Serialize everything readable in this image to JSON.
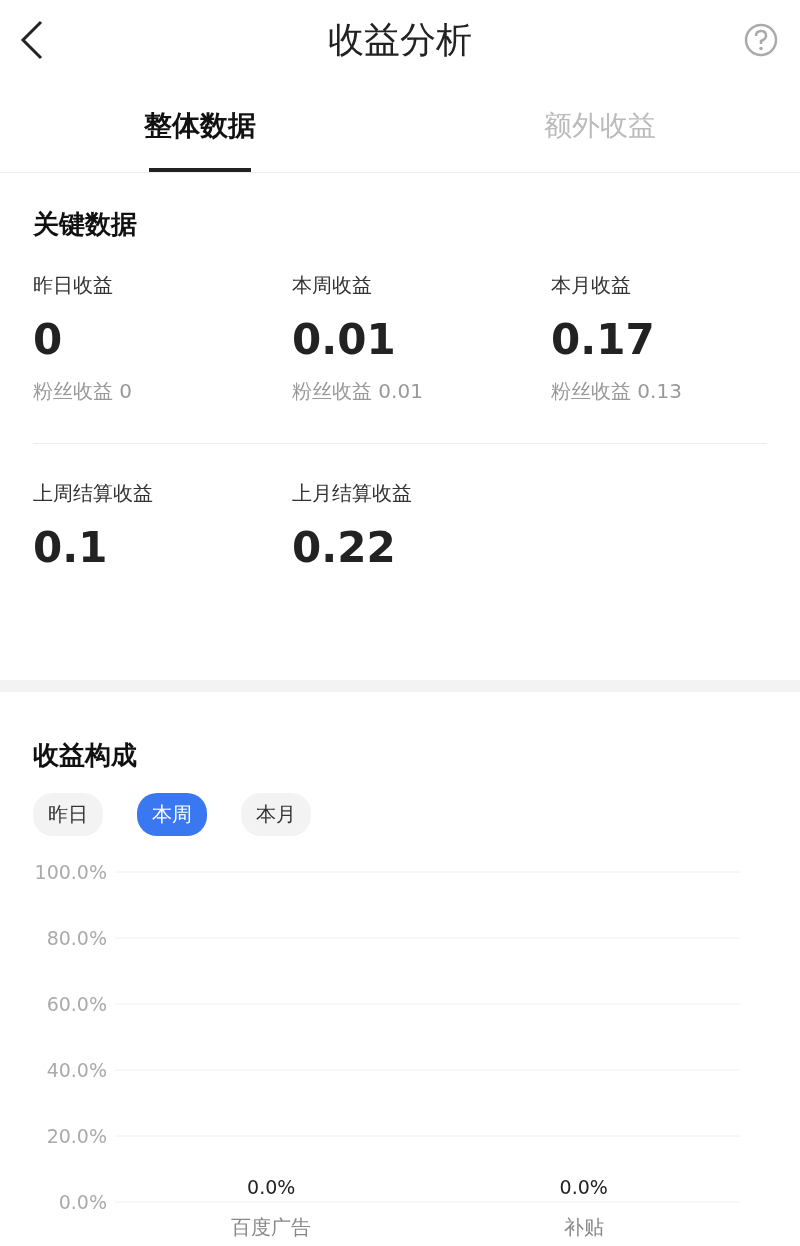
{
  "header": {
    "title": "收益分析"
  },
  "tabs": [
    {
      "label": "整体数据",
      "selected": true
    },
    {
      "label": "额外收益",
      "selected": false
    }
  ],
  "key_data": {
    "title": "关键数据",
    "metrics": [
      {
        "label": "昨日收益",
        "value": "0",
        "sub": "粉丝收益 0"
      },
      {
        "label": "本周收益",
        "value": "0.01",
        "sub": "粉丝收益 0.01"
      },
      {
        "label": "本月收益",
        "value": "0.17",
        "sub": "粉丝收益 0.13"
      }
    ],
    "settled": [
      {
        "label": "上周结算收益",
        "value": "0.1"
      },
      {
        "label": "上月结算收益",
        "value": "0.22"
      }
    ]
  },
  "composition": {
    "title": "收益构成",
    "periods": [
      {
        "label": "昨日",
        "selected": false
      },
      {
        "label": "本周",
        "selected": true
      },
      {
        "label": "本月",
        "selected": false
      }
    ],
    "chart_data": {
      "type": "bar",
      "grid": true,
      "categories": [
        "百度广告",
        "补贴"
      ],
      "values": [
        0,
        0
      ],
      "ylim": [
        0,
        1
      ],
      "yticks": [
        {
          "value": 0,
          "label": "0.0%"
        },
        {
          "value": 0.2,
          "label": "20.0%"
        },
        {
          "value": 0.4,
          "label": "40.0%"
        },
        {
          "value": 0.6,
          "label": "60.0%"
        },
        {
          "value": 0.8,
          "label": "80.0%"
        },
        {
          "value": 1,
          "label": "100.0%"
        }
      ],
      "value_labels": [
        "0.0%",
        "0.0%"
      ]
    }
  }
}
